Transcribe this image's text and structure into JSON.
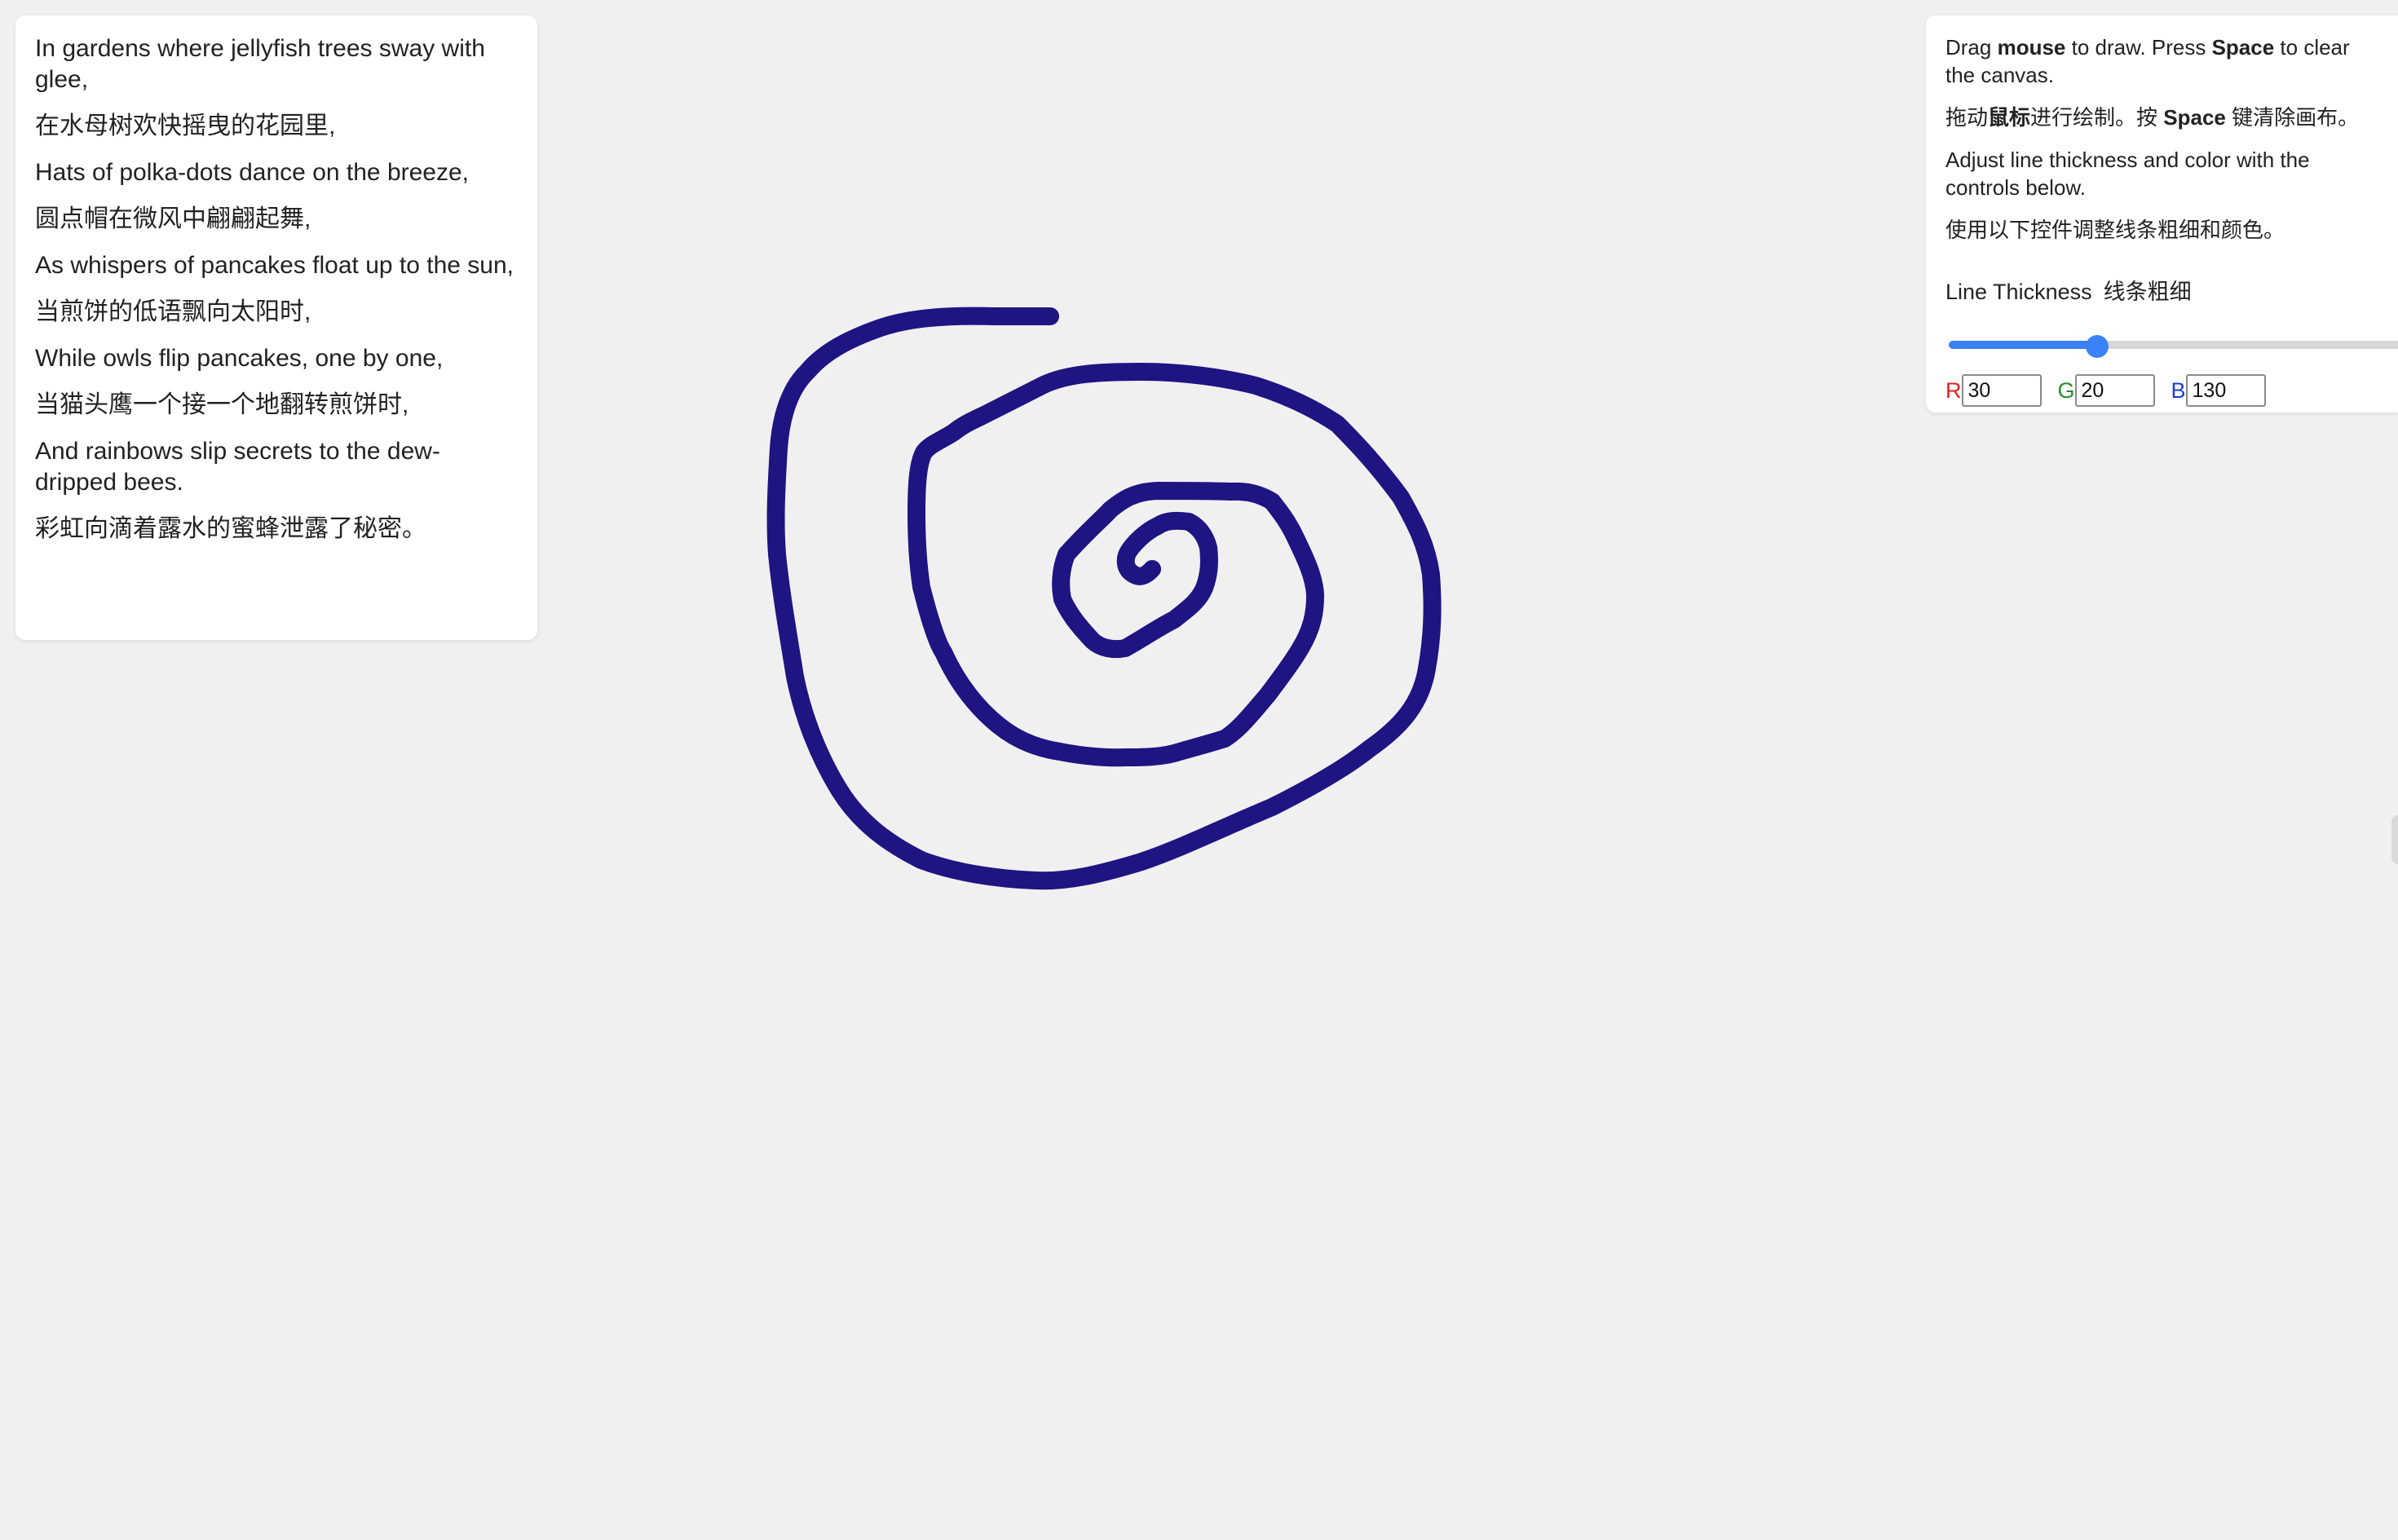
{
  "poem": {
    "lines": [
      "In gardens where jellyfish trees sway with glee,",
      "在水母树欢快摇曳的花园里,",
      "Hats of polka-dots dance on the breeze,",
      "圆点帽在微风中翩翩起舞,",
      "As whispers of pancakes float up to the sun,",
      "当煎饼的低语飘向太阳时,",
      "While owls flip pancakes, one by one,",
      "当猫头鹰一个接一个地翻转煎饼时,",
      "And rainbows slip secrets to the dew-dripped bees.",
      "彩虹向滴着露水的蜜蜂泄露了秘密。"
    ]
  },
  "controls": {
    "instruction_en": {
      "prefix": "Drag ",
      "mouse": "mouse",
      "middle": " to draw. Press ",
      "space": "Space",
      "suffix": " to clear the canvas."
    },
    "instruction_zh": {
      "prefix": "拖动",
      "mouse": "鼠标",
      "middle": "进行绘制。按 ",
      "space": "Space",
      "suffix": " 键清除画布。"
    },
    "adjust_en": "Adjust line thickness and color with the controls below.",
    "adjust_zh": "使用以下控件调整线条粗细和颜色。",
    "thickness_label_en": "Line Thickness",
    "thickness_label_zh": "线条粗细",
    "thickness_fraction": 0.285,
    "rgb": {
      "r_label": "R",
      "r_value": "30",
      "g_label": "G",
      "g_value": "20",
      "b_label": "B",
      "b_value": "130"
    },
    "label_colors": {
      "r": "#e02020",
      "g": "#2a8a2a",
      "b": "#1a3fd6"
    }
  },
  "drawing": {
    "stroke_color": "#1e1482",
    "shape": "hand-drawn spiral"
  }
}
